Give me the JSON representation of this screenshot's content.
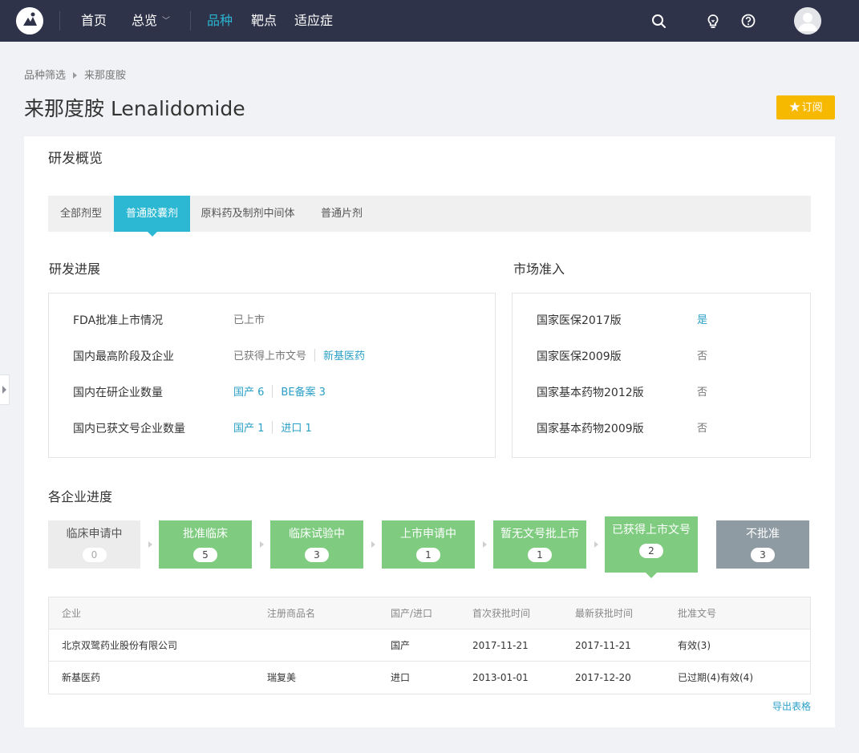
{
  "nav": {
    "items": [
      {
        "label": "首页"
      },
      {
        "label": "总览"
      },
      {
        "label": "品种"
      },
      {
        "label": "靶点"
      },
      {
        "label": "适应症"
      }
    ],
    "active": "品种",
    "icons": [
      "search-icon",
      "lightbulb-icon",
      "help-icon",
      "user-avatar"
    ]
  },
  "breadcrumb": {
    "root": "品种筛选",
    "current": "来那度胺"
  },
  "page_title": "来那度胺 Lenalidomide",
  "subscribe": {
    "star": "★",
    "label": "订阅"
  },
  "overview": {
    "title": "研发概览",
    "tabs": [
      {
        "label": "全部剂型"
      },
      {
        "label": "普通胶囊剂"
      },
      {
        "label": "原料药及制剂中间体"
      },
      {
        "label": "普通片剂"
      }
    ],
    "active_tab": "普通胶囊剂"
  },
  "progress": {
    "title": "研发进展",
    "rows": [
      {
        "label": "FDA批准上市情况",
        "value": "已上市"
      },
      {
        "label": "国内最高阶段及企业",
        "value": "已获得上市文号",
        "link": "新基医药"
      },
      {
        "label": "国内在研企业数量",
        "link1": "国产 6",
        "link2": "BE备案 3"
      },
      {
        "label": "国内已获文号企业数量",
        "link1": "国产 1",
        "link2": "进口 1"
      }
    ]
  },
  "market": {
    "title": "市场准入",
    "rows": [
      {
        "label": "国家医保2017版",
        "value": "是",
        "highlight": true
      },
      {
        "label": "国家医保2009版",
        "value": "否"
      },
      {
        "label": "国家基本药物2012版",
        "value": "否"
      },
      {
        "label": "国家基本药物2009版",
        "value": "否"
      }
    ]
  },
  "companies": {
    "title": "各企业进度",
    "steps": [
      {
        "label": "临床申请中",
        "count": "0",
        "style": "grey"
      },
      {
        "label": "批准临床",
        "count": "5",
        "style": "green"
      },
      {
        "label": "临床试验中",
        "count": "3",
        "style": "green"
      },
      {
        "label": "上市申请中",
        "count": "1",
        "style": "green"
      },
      {
        "label": "暂无文号批上市",
        "count": "1",
        "style": "green"
      },
      {
        "label": "已获得上市文号",
        "count": "2",
        "style": "green",
        "selected": true
      },
      {
        "label": "不批准",
        "count": "3",
        "style": "slate"
      }
    ],
    "table": {
      "headers": [
        "企业",
        "注册商品名",
        "国产/进口",
        "首次获批时间",
        "最新获批时间",
        "批准文号"
      ],
      "rows": [
        {
          "company": "北京双鹭药业股份有限公司",
          "brand": "",
          "origin": "国产",
          "first": "2017-11-21",
          "latest": "2017-11-21",
          "approval": "有效(3)"
        },
        {
          "company": "新基医药",
          "brand": "瑞复美",
          "origin": "进口",
          "first": "2013-01-01",
          "latest": "2017-12-20",
          "approval": "已过期(4)有效(4)"
        }
      ]
    },
    "export_label": "导出表格"
  },
  "colors": {
    "nav_bg": "#2f3349",
    "accent": "#2cb8d3",
    "link": "#2a9fc6",
    "subscribe": "#f7b900",
    "step_green": "#7fcc80",
    "step_slate": "#8f9ba3"
  }
}
